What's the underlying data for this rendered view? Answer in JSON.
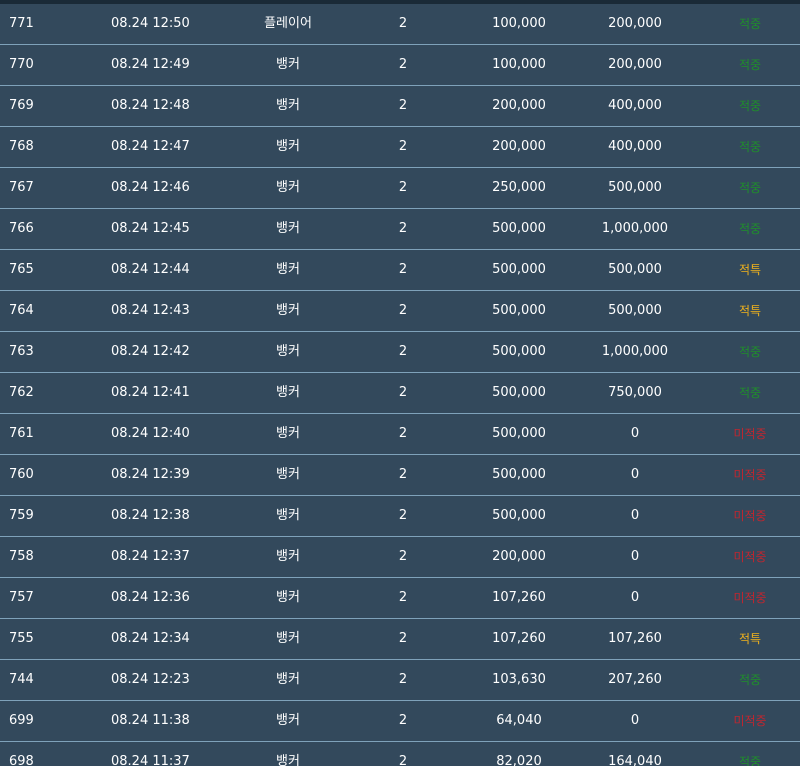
{
  "colors": {
    "background": "#33495c",
    "row_divider": "#7fa2ba",
    "text": "#ffffff",
    "hit": "#1f8f2a",
    "refund": "#f2b31b",
    "miss": "#c0262f"
  },
  "rows": [
    {
      "no": "771",
      "date": "08.24 12:50",
      "pick": "플레이어",
      "odds": "2",
      "bet": "100,000",
      "win": "200,000",
      "result": "적중",
      "status": "hit"
    },
    {
      "no": "770",
      "date": "08.24 12:49",
      "pick": "뱅커",
      "odds": "2",
      "bet": "100,000",
      "win": "200,000",
      "result": "적중",
      "status": "hit"
    },
    {
      "no": "769",
      "date": "08.24 12:48",
      "pick": "뱅커",
      "odds": "2",
      "bet": "200,000",
      "win": "400,000",
      "result": "적중",
      "status": "hit"
    },
    {
      "no": "768",
      "date": "08.24 12:47",
      "pick": "뱅커",
      "odds": "2",
      "bet": "200,000",
      "win": "400,000",
      "result": "적중",
      "status": "hit"
    },
    {
      "no": "767",
      "date": "08.24 12:46",
      "pick": "뱅커",
      "odds": "2",
      "bet": "250,000",
      "win": "500,000",
      "result": "적중",
      "status": "hit"
    },
    {
      "no": "766",
      "date": "08.24 12:45",
      "pick": "뱅커",
      "odds": "2",
      "bet": "500,000",
      "win": "1,000,000",
      "result": "적중",
      "status": "hit"
    },
    {
      "no": "765",
      "date": "08.24 12:44",
      "pick": "뱅커",
      "odds": "2",
      "bet": "500,000",
      "win": "500,000",
      "result": "적특",
      "status": "refund"
    },
    {
      "no": "764",
      "date": "08.24 12:43",
      "pick": "뱅커",
      "odds": "2",
      "bet": "500,000",
      "win": "500,000",
      "result": "적특",
      "status": "refund"
    },
    {
      "no": "763",
      "date": "08.24 12:42",
      "pick": "뱅커",
      "odds": "2",
      "bet": "500,000",
      "win": "1,000,000",
      "result": "적중",
      "status": "hit"
    },
    {
      "no": "762",
      "date": "08.24 12:41",
      "pick": "뱅커",
      "odds": "2",
      "bet": "500,000",
      "win": "750,000",
      "result": "적중",
      "status": "hit"
    },
    {
      "no": "761",
      "date": "08.24 12:40",
      "pick": "뱅커",
      "odds": "2",
      "bet": "500,000",
      "win": "0",
      "result": "미적중",
      "status": "miss"
    },
    {
      "no": "760",
      "date": "08.24 12:39",
      "pick": "뱅커",
      "odds": "2",
      "bet": "500,000",
      "win": "0",
      "result": "미적중",
      "status": "miss"
    },
    {
      "no": "759",
      "date": "08.24 12:38",
      "pick": "뱅커",
      "odds": "2",
      "bet": "500,000",
      "win": "0",
      "result": "미적중",
      "status": "miss"
    },
    {
      "no": "758",
      "date": "08.24 12:37",
      "pick": "뱅커",
      "odds": "2",
      "bet": "200,000",
      "win": "0",
      "result": "미적중",
      "status": "miss"
    },
    {
      "no": "757",
      "date": "08.24 12:36",
      "pick": "뱅커",
      "odds": "2",
      "bet": "107,260",
      "win": "0",
      "result": "미적중",
      "status": "miss"
    },
    {
      "no": "755",
      "date": "08.24 12:34",
      "pick": "뱅커",
      "odds": "2",
      "bet": "107,260",
      "win": "107,260",
      "result": "적특",
      "status": "refund"
    },
    {
      "no": "744",
      "date": "08.24 12:23",
      "pick": "뱅커",
      "odds": "2",
      "bet": "103,630",
      "win": "207,260",
      "result": "적중",
      "status": "hit"
    },
    {
      "no": "699",
      "date": "08.24 11:38",
      "pick": "뱅커",
      "odds": "2",
      "bet": "64,040",
      "win": "0",
      "result": "미적중",
      "status": "miss"
    },
    {
      "no": "698",
      "date": "08.24 11:37",
      "pick": "뱅커",
      "odds": "2",
      "bet": "82,020",
      "win": "164,040",
      "result": "적중",
      "status": "hit"
    }
  ]
}
